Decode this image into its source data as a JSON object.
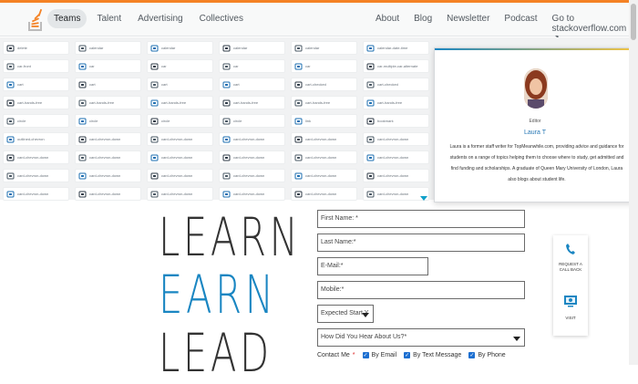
{
  "nav": {
    "left": [
      "Teams",
      "Talent",
      "Advertising",
      "Collectives"
    ],
    "right": [
      "About",
      "Blog",
      "Newsletter",
      "Podcast",
      "Go to stackoverflow.com"
    ],
    "active": "Teams",
    "brand_color": "#f48225"
  },
  "icon_grid": {
    "rows": [
      [
        "delete",
        "calendar",
        "calendar",
        "calendar",
        "calendar",
        "calendar-date-time"
      ],
      [
        "car-front",
        "car",
        "car",
        "car",
        "car",
        "car-multiple-car-alternate"
      ],
      [
        "cart",
        "cart",
        "cart",
        "cart",
        "cart-checked",
        "cart-checked"
      ],
      [
        "cart-hands-free",
        "cart-hands-free",
        "cart-hands-free",
        "cart-hands-free",
        "cart-hands-free",
        "cart-hands-free"
      ],
      [
        "circle",
        "circle",
        "circle",
        "circle",
        "link",
        "bookmark"
      ],
      [
        "outlined-chevron",
        "card-chevron-down",
        "card-chevron-down",
        "card-chevron-down",
        "card-chevron-down",
        "card-chevron-down"
      ],
      [
        "card-chevron-down",
        "card-chevron-down",
        "card-chevron-down",
        "card-chevron-down",
        "card-chevron-down",
        "card-chevron-down"
      ],
      [
        "card-chevron-down",
        "card-chevron-down",
        "card-chevron-down",
        "card-chevron-down",
        "card-chevron-down",
        "card-chevron-down"
      ],
      [
        "card-chevron-down",
        "card-chevron-down",
        "card-chevron-down",
        "card-chevron-down",
        "card-chevron-down",
        "card-chevron-down"
      ]
    ]
  },
  "profile": {
    "role": "Editor",
    "name": "Laura T",
    "bio": "Laura is a former staff writer for TopMeanwhile.com, providing advice and guidance for students on a range of topics helping them to choose where to study, get admitted and find funding and scholarships. A graduate of Queen Mary University of London, Laura also blogs about student life.",
    "link_color": "#2878b5"
  },
  "hero": {
    "line1": "LEARN",
    "line2": "EARN",
    "line3": "LEAD",
    "accent": "#1a86c2"
  },
  "form": {
    "first_name": "First Name: *",
    "last_name": "Last Name:*",
    "email": "E-Mail:*",
    "mobile": "Mobile:*",
    "expected_start": "Expected Start Y",
    "hear_about": "How Did You Hear About Us?*",
    "contact_label": "Contact Me",
    "contact_req": "*",
    "options": [
      "By Email",
      "By Text Message",
      "By Phone"
    ]
  },
  "side_widget": {
    "callback": "REQUEST A CALL BACK",
    "visit": "VISIT"
  }
}
